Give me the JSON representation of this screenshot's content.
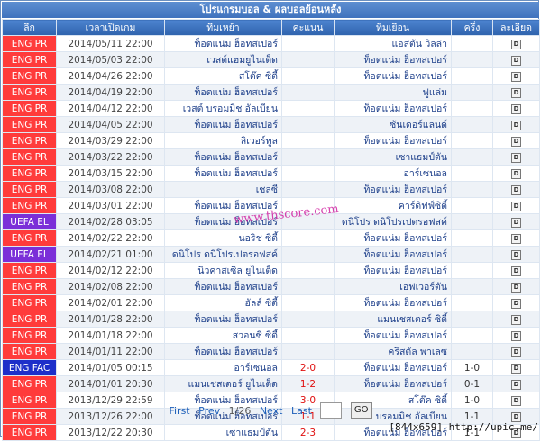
{
  "title": "โปรแกรมบอล & ผลบอลย้อนหลัง",
  "columns": [
    "ลีก",
    "เวลาเปิดเกม",
    "ทีมเหย้า",
    "คะแนน",
    "ทีมเยือน",
    "ครึ่ง",
    "ละเอียด"
  ],
  "league_colors": {
    "ENG PR": "#ff3b3b",
    "UEFA EL": "#7b2fd8",
    "ENG FAC": "#1d2fc9"
  },
  "rows": [
    {
      "league": "ENG PR",
      "time": "2014/05/11 22:00",
      "home": "ท็อตแน่ม ฮ็อทสเปอร์",
      "score": "",
      "away": "แอสตัน วิลล่า",
      "half": "",
      "detail": "D"
    },
    {
      "league": "ENG PR",
      "time": "2014/05/03 22:00",
      "home": "เวสต์แฮมยูไนเต็ด",
      "score": "",
      "away": "ท็อตแน่ม ฮ็อทสเปอร์",
      "half": "",
      "detail": "D"
    },
    {
      "league": "ENG PR",
      "time": "2014/04/26 22:00",
      "home": "สโต๊ค ซิตี้",
      "score": "",
      "away": "ท็อตแน่ม ฮ็อทสเปอร์",
      "half": "",
      "detail": "D"
    },
    {
      "league": "ENG PR",
      "time": "2014/04/19 22:00",
      "home": "ท็อตแน่ม ฮ็อทสเปอร์",
      "score": "",
      "away": "ฟูแล่ม",
      "half": "",
      "detail": "D"
    },
    {
      "league": "ENG PR",
      "time": "2014/04/12 22:00",
      "home": "เวสต์ บรอมมิช อัลเบียน",
      "score": "",
      "away": "ท็อตแน่ม ฮ็อทสเปอร์",
      "half": "",
      "detail": "D"
    },
    {
      "league": "ENG PR",
      "time": "2014/04/05 22:00",
      "home": "ท็อตแน่ม ฮ็อทสเปอร์",
      "score": "",
      "away": "ซันเดอร์แลนด์",
      "half": "",
      "detail": "D"
    },
    {
      "league": "ENG PR",
      "time": "2014/03/29 22:00",
      "home": "ลิเวอร์พูล",
      "score": "",
      "away": "ท็อตแน่ม ฮ็อทสเปอร์",
      "half": "",
      "detail": "D"
    },
    {
      "league": "ENG PR",
      "time": "2014/03/22 22:00",
      "home": "ท็อตแน่ม ฮ็อทสเปอร์",
      "score": "",
      "away": "เซาแธมป์ตัน",
      "half": "",
      "detail": "D"
    },
    {
      "league": "ENG PR",
      "time": "2014/03/15 22:00",
      "home": "ท็อตแน่ม ฮ็อทสเปอร์",
      "score": "",
      "away": "อาร์เซนอล",
      "half": "",
      "detail": "D"
    },
    {
      "league": "ENG PR",
      "time": "2014/03/08 22:00",
      "home": "เชลซี",
      "score": "",
      "away": "ท็อตแน่ม ฮ็อทสเปอร์",
      "half": "",
      "detail": "D"
    },
    {
      "league": "ENG PR",
      "time": "2014/03/01 22:00",
      "home": "ท็อตแน่ม ฮ็อทสเปอร์",
      "score": "",
      "away": "คาร์ดิฟฟ์ซิตี้",
      "half": "",
      "detail": "D"
    },
    {
      "league": "UEFA EL",
      "time": "2014/02/28 03:05",
      "home": "ท็อตแน่ม ฮ็อทสเปอร์",
      "score": "",
      "away": "ดนิโปร ดนิโปรเปตรอฟสค์",
      "half": "",
      "detail": "D"
    },
    {
      "league": "ENG PR",
      "time": "2014/02/22 22:00",
      "home": "นอริช ซิตี้",
      "score": "",
      "away": "ท็อตแน่ม ฮ็อทสเปอร์",
      "half": "",
      "detail": "D"
    },
    {
      "league": "UEFA EL",
      "time": "2014/02/21 01:00",
      "home": "ดนิโปร ดนิโปรเปตรอฟสค์",
      "score": "",
      "away": "ท็อตแน่ม ฮ็อทสเปอร์",
      "half": "",
      "detail": "D"
    },
    {
      "league": "ENG PR",
      "time": "2014/02/12 22:00",
      "home": "นิวคาสเซิล ยูไนเต็ด",
      "score": "",
      "away": "ท็อตแน่ม ฮ็อทสเปอร์",
      "half": "",
      "detail": "D"
    },
    {
      "league": "ENG PR",
      "time": "2014/02/08 22:00",
      "home": "ท็อตแน่ม ฮ็อทสเปอร์",
      "score": "",
      "away": "เอฟเวอร์ตัน",
      "half": "",
      "detail": "D"
    },
    {
      "league": "ENG PR",
      "time": "2014/02/01 22:00",
      "home": "ฮัลล์ ซิตี้",
      "score": "",
      "away": "ท็อตแน่ม ฮ็อทสเปอร์",
      "half": "",
      "detail": "D"
    },
    {
      "league": "ENG PR",
      "time": "2014/01/28 22:00",
      "home": "ท็อตแน่ม ฮ็อทสเปอร์",
      "score": "",
      "away": "แมนเชสเตอร์ ซิตี้",
      "half": "",
      "detail": "D"
    },
    {
      "league": "ENG PR",
      "time": "2014/01/18 22:00",
      "home": "สวอนซี ซิตี้",
      "score": "",
      "away": "ท็อตแน่ม ฮ็อทสเปอร์",
      "half": "",
      "detail": "D"
    },
    {
      "league": "ENG PR",
      "time": "2014/01/11 22:00",
      "home": "ท็อตแน่ม ฮ็อทสเปอร์",
      "score": "",
      "away": "คริสตัล พาเลซ",
      "half": "",
      "detail": "D"
    },
    {
      "league": "ENG FAC",
      "time": "2014/01/05 00:15",
      "home": "อาร์เซนอล",
      "score": "2-0",
      "away": "ท็อตแน่ม ฮ็อทสเปอร์",
      "half": "1-0",
      "detail": "D"
    },
    {
      "league": "ENG PR",
      "time": "2014/01/01 20:30",
      "home": "แมนเชสเตอร์ ยูไนเต็ด",
      "score": "1-2",
      "away": "ท็อตแน่ม ฮ็อทสเปอร์",
      "half": "0-1",
      "detail": "D"
    },
    {
      "league": "ENG PR",
      "time": "2013/12/29 22:59",
      "home": "ท็อตแน่ม ฮ็อทสเปอร์",
      "score": "3-0",
      "away": "สโต๊ค ซิตี้",
      "half": "1-0",
      "detail": "D"
    },
    {
      "league": "ENG PR",
      "time": "2013/12/26 22:00",
      "home": "ท็อตแน่ม ฮ็อทสเปอร์",
      "score": "1-1",
      "away": "เวสต์ บรอมมิช อัลเบียน",
      "half": "1-1",
      "detail": "D"
    },
    {
      "league": "ENG PR",
      "time": "2013/12/22 20:30",
      "home": "เซาแธมป์ตัน",
      "score": "2-3",
      "away": "ท็อตแน่ม ฮ็อทสเปอร์",
      "half": "1-1",
      "detail": "D"
    }
  ],
  "pager": {
    "first": "First",
    "prev": "Prev",
    "page": "1/26",
    "next": "Next",
    "last": "Last",
    "go": "GO"
  },
  "watermark": "www.thscore.com",
  "footer": "[844x659] http://upic.me/"
}
